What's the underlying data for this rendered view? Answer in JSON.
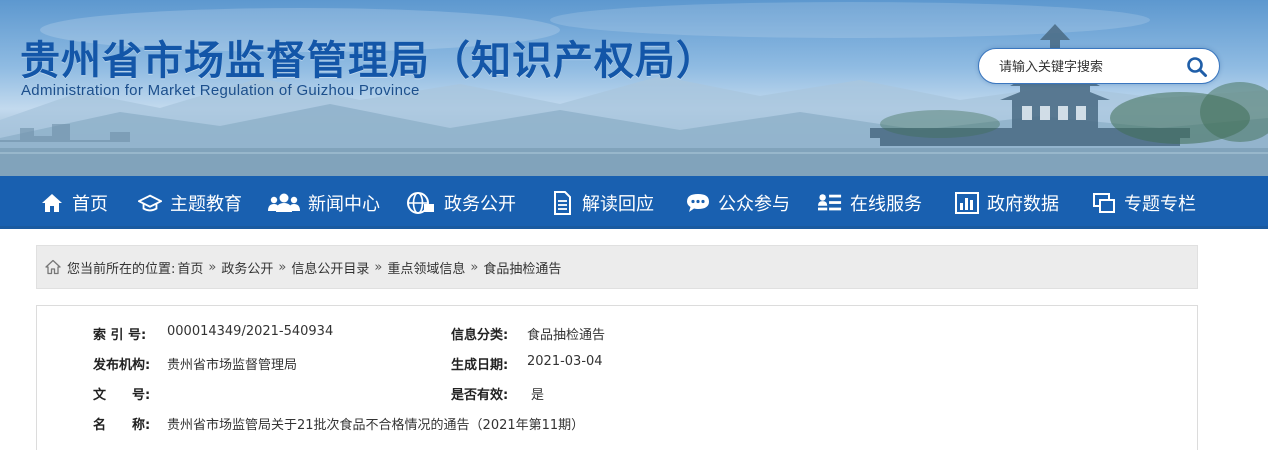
{
  "header": {
    "title": "贵州省市场监督管理局（知识产权局）",
    "subtitle": "Administration for Market Regulation of Guizhou Province"
  },
  "search": {
    "placeholder": "请输入关键字搜索"
  },
  "nav": {
    "items": [
      {
        "label": "首页",
        "icon": "home-icon"
      },
      {
        "label": "主题教育",
        "icon": "graduation-cap-icon"
      },
      {
        "label": "新闻中心",
        "icon": "users-icon"
      },
      {
        "label": "政务公开",
        "icon": "globe-icon"
      },
      {
        "label": "解读回应",
        "icon": "document-icon"
      },
      {
        "label": "公众参与",
        "icon": "chat-bubble-icon"
      },
      {
        "label": "在线服务",
        "icon": "user-list-icon"
      },
      {
        "label": "政府数据",
        "icon": "bar-chart-icon"
      },
      {
        "label": "专题专栏",
        "icon": "windows-stack-icon"
      }
    ]
  },
  "breadcrumb": {
    "prefix": "您当前所在的位置:",
    "separator": "»",
    "items": [
      "首页",
      "政务公开",
      "信息公开目录",
      "重点领域信息",
      "食品抽检通告"
    ]
  },
  "info": {
    "index_label": "索 引 号:",
    "index_value": "000014349/2021-540934",
    "category_label": "信息分类:",
    "category_value": "食品抽检通告",
    "publisher_label": "发布机构:",
    "publisher_value": "贵州省市场监督管理局",
    "date_label": "生成日期:",
    "date_value": "2021-03-04",
    "docno_label": "文　　号:",
    "docno_value": "",
    "valid_label": "是否有效:",
    "valid_value": "是",
    "name_label": "名　　称:",
    "name_value": "贵州省市场监管局关于21批次食品不合格情况的通告（2021年第11期）"
  },
  "colors": {
    "nav_bg": "#1960b0",
    "title_blue": "#1356a8",
    "crumb_bg": "#ececec"
  }
}
